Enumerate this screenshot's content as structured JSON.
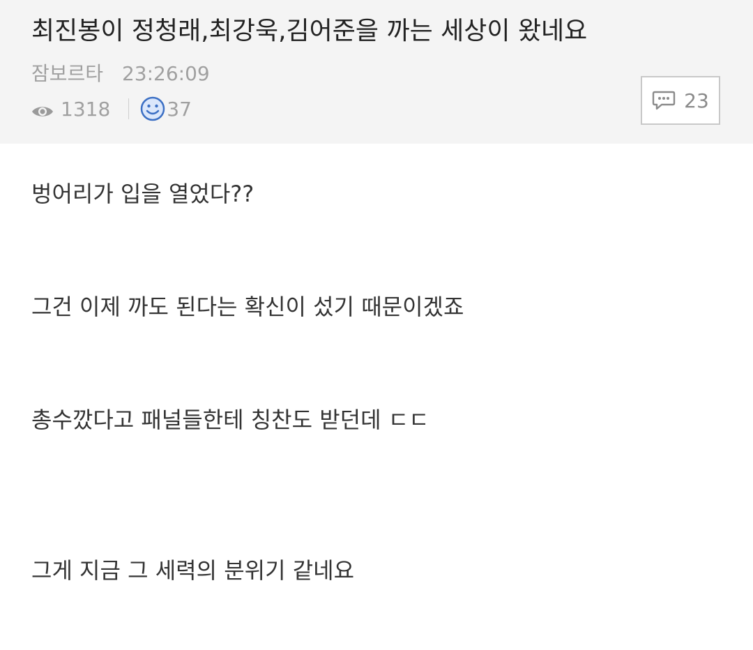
{
  "post": {
    "title": "최진봉이 정청래,최강욱,김어준을 까는 세상이 왔네요",
    "author": "잠보르타",
    "time": "23:26:09",
    "views": "1318",
    "likes": "37",
    "comments": "23"
  },
  "content": {
    "lines": [
      "벙어리가 입을 열었다??",
      "그건 이제 까도 된다는 확신이 섰기 때문이겠죠",
      "총수깠다고 패널들한테 칭찬도 받던데 ㄷㄷ",
      "그게 지금 그 세력의 분위기 같네요"
    ]
  },
  "icons": {
    "views": "eye-icon",
    "likes": "smiley-icon",
    "comments": "speech-bubble-icon"
  },
  "colors": {
    "header_bg": "#f4f4f4",
    "meta_text": "#a0a0a0",
    "smiley": "#3b6fc4"
  }
}
